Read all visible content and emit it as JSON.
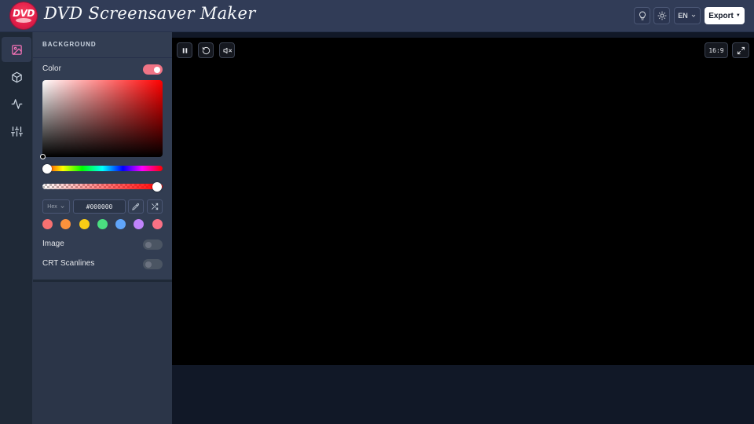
{
  "header": {
    "logo_text": "DVD",
    "title": "DVD Screensaver Maker",
    "lang": "EN",
    "export_label": "Export",
    "icons": [
      "lightbulb-icon",
      "sun-icon",
      "chevron-down-icon",
      "caret-down-icon"
    ]
  },
  "rail": {
    "items": [
      "image-icon",
      "cube-icon",
      "activity-icon",
      "sliders-icon"
    ]
  },
  "background_section": {
    "title": "BACKGROUND",
    "color_label": "Color",
    "color_enabled": true,
    "hue_position": 0,
    "alpha_position": 1,
    "format": "Hex",
    "hex_value": "#000000",
    "swatches": [
      "#f87171",
      "#fb923c",
      "#facc15",
      "#4ade80",
      "#60a5fa",
      "#c084fc",
      "#fb7185"
    ],
    "image_label": "Image",
    "image_enabled": false,
    "crt_label": "CRT Scanlines",
    "crt_enabled": false
  },
  "preview": {
    "aspect_ratio": "16:9",
    "background_color": "#000000",
    "icons": [
      "pause-icon",
      "restart-icon",
      "mute-icon",
      "fullscreen-icon"
    ]
  }
}
